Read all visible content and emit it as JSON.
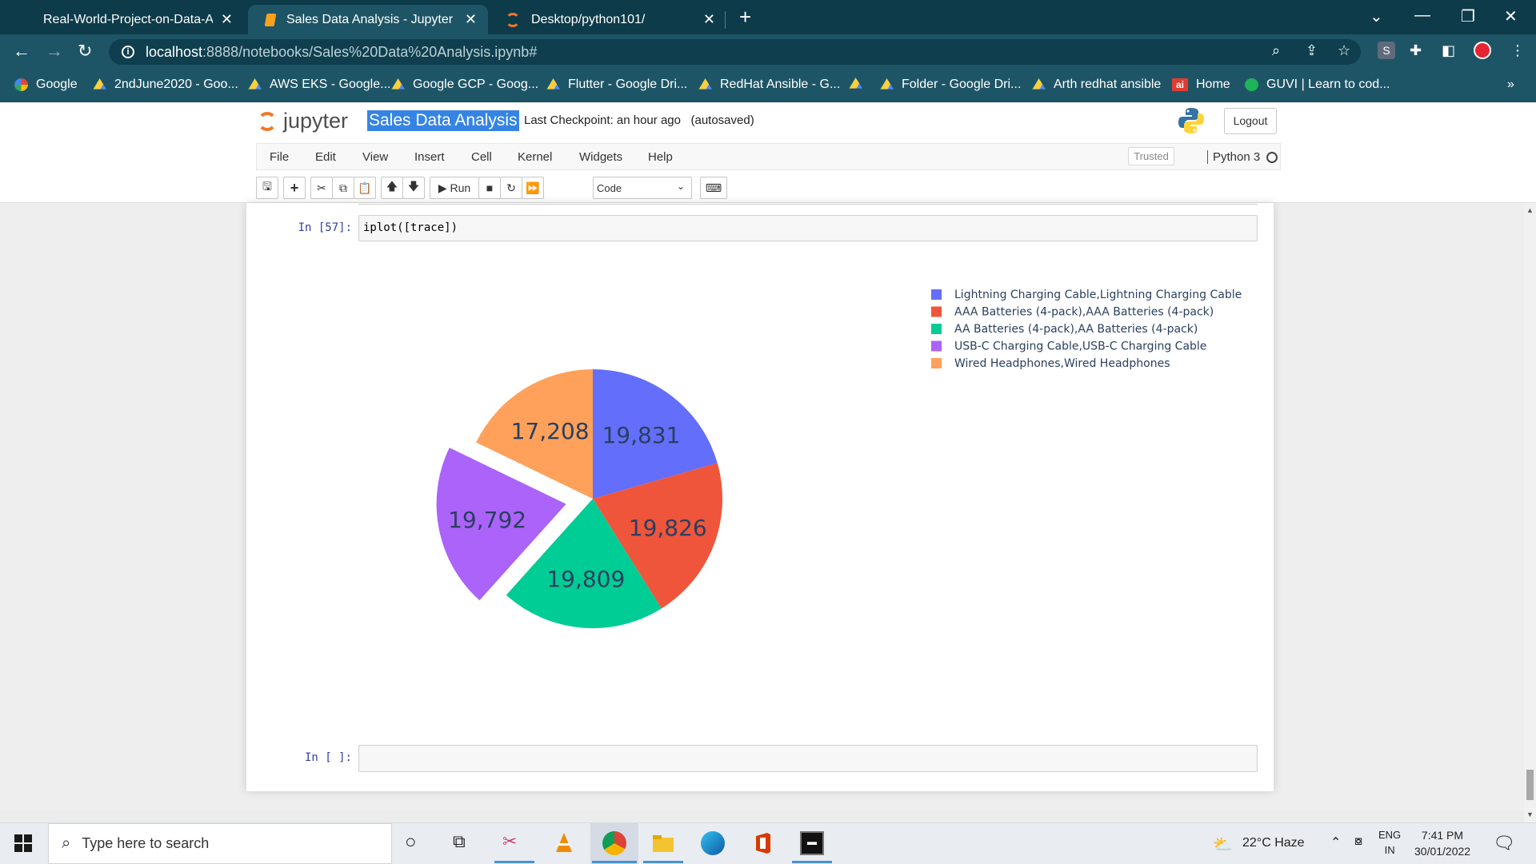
{
  "browser": {
    "tabs": [
      {
        "title": "Real-World-Project-on-Data-Ana",
        "active": false
      },
      {
        "title": "Sales Data Analysis - Jupyter Not",
        "active": true
      },
      {
        "title": "Desktop/python101/",
        "active": false
      }
    ],
    "url_host": "localhost",
    "url_path": ":8888/notebooks/Sales%20Data%20Analysis.ipynb#",
    "profile_initial": "S",
    "bookmarks": [
      {
        "label": "Google",
        "icon": "google-icon"
      },
      {
        "label": "2ndJune2020 - Goo...",
        "icon": "google-drive-icon"
      },
      {
        "label": "AWS EKS - Google...",
        "icon": "google-drive-icon"
      },
      {
        "label": "Google GCP - Goog...",
        "icon": "google-drive-icon"
      },
      {
        "label": "Flutter - Google Dri...",
        "icon": "google-drive-icon"
      },
      {
        "label": "RedHat Ansible - G...",
        "icon": "google-drive-icon"
      },
      {
        "label": "",
        "icon": "google-drive-icon"
      },
      {
        "label": "Folder - Google Dri...",
        "icon": "google-drive-icon"
      },
      {
        "label": "Arth redhat ansible",
        "icon": "google-drive-icon"
      },
      {
        "label": "Home",
        "icon": "ai-icon"
      },
      {
        "label": "GUVI | Learn to cod...",
        "icon": "guvi-icon"
      }
    ],
    "more_bookmarks": "»"
  },
  "jupyter": {
    "logo_text": "jupyter",
    "notebook_name": "Sales Data Analysis",
    "checkpoint": "Last Checkpoint: an hour ago",
    "autosave": "(autosaved)",
    "logout": "Logout",
    "menu": [
      "File",
      "Edit",
      "View",
      "Insert",
      "Cell",
      "Kernel",
      "Widgets",
      "Help"
    ],
    "trusted": "Trusted",
    "kernel": "Python 3",
    "run_label": "Run",
    "cell_type": "Code"
  },
  "cells": [
    {
      "prompt": "In [57]:",
      "code": "iplot([trace])"
    },
    {
      "prompt": "In [ ]:",
      "code": ""
    }
  ],
  "chart_data": {
    "type": "pie",
    "labels": [
      "Lightning Charging Cable,Lightning Charging Cable",
      "AAA Batteries (4-pack),AAA Batteries (4-pack)",
      "AA Batteries (4-pack),AA Batteries (4-pack)",
      "USB-C Charging Cable,USB-C Charging Cable",
      "Wired Headphones,Wired Headphones"
    ],
    "values": [
      19831,
      19826,
      19809,
      19792,
      17208
    ],
    "text_labels": [
      "19,831",
      "19,826",
      "19,809",
      "19,792",
      "17,208"
    ],
    "colors": [
      "#636efa",
      "#ef553b",
      "#00cc96",
      "#ab63fa",
      "#ffa15a"
    ],
    "pulled_slice": "USB-C Charging Cable,USB-C Charging Cable",
    "legend_position": "top-right"
  },
  "taskbar": {
    "search_placeholder": "Type here to search",
    "weather": "22°C  Haze",
    "lang_top": "ENG",
    "lang_bottom": "IN",
    "time": "7:41 PM",
    "date": "30/01/2022"
  }
}
